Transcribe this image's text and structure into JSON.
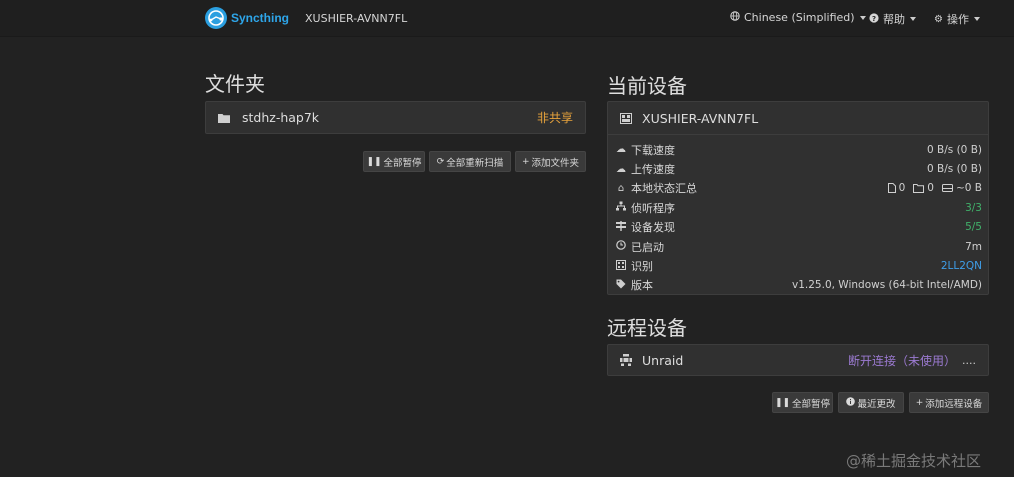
{
  "navbar": {
    "brand": "Syncthing",
    "device_name": "XUSHIER-AVNN7FL",
    "language": "Chinese (Simplified)",
    "help": "帮助",
    "actions": "操作"
  },
  "folders": {
    "heading": "文件夹",
    "items": [
      {
        "name": "stdhz-hap7k",
        "status": "非共享"
      }
    ],
    "buttons": {
      "pause_all": "全部暂停",
      "rescan_all": "全部重新扫描",
      "add_folder": "添加文件夹"
    }
  },
  "this_device": {
    "heading": "当前设备",
    "name": "XUSHIER-AVNN7FL",
    "rows": {
      "download_label": "下载速度",
      "download_value": "0 B/s (0 B)",
      "upload_label": "上传速度",
      "upload_value": "0 B/s (0 B)",
      "local_state_label": "本地状态汇总",
      "local_files": "0",
      "local_dirs": "0",
      "local_size": "~0 B",
      "listeners_label": "侦听程序",
      "listeners_value": "3/3",
      "discovery_label": "设备发现",
      "discovery_value": "5/5",
      "uptime_label": "已启动",
      "uptime_value": "7m",
      "id_label": "识别",
      "id_value": "2LL2QN",
      "version_label": "版本",
      "version_value": "v1.25.0, Windows (64-bit Intel/AMD)"
    }
  },
  "remote_devices": {
    "heading": "远程设备",
    "items": [
      {
        "name": "Unraid",
        "status": "断开连接（未使用）",
        "extra": "...."
      }
    ],
    "buttons": {
      "pause_all": "全部暂停",
      "recent_changes": "最近更改",
      "add_remote": "添加远程设备"
    }
  },
  "watermark": "@稀土掘金技术社区"
}
